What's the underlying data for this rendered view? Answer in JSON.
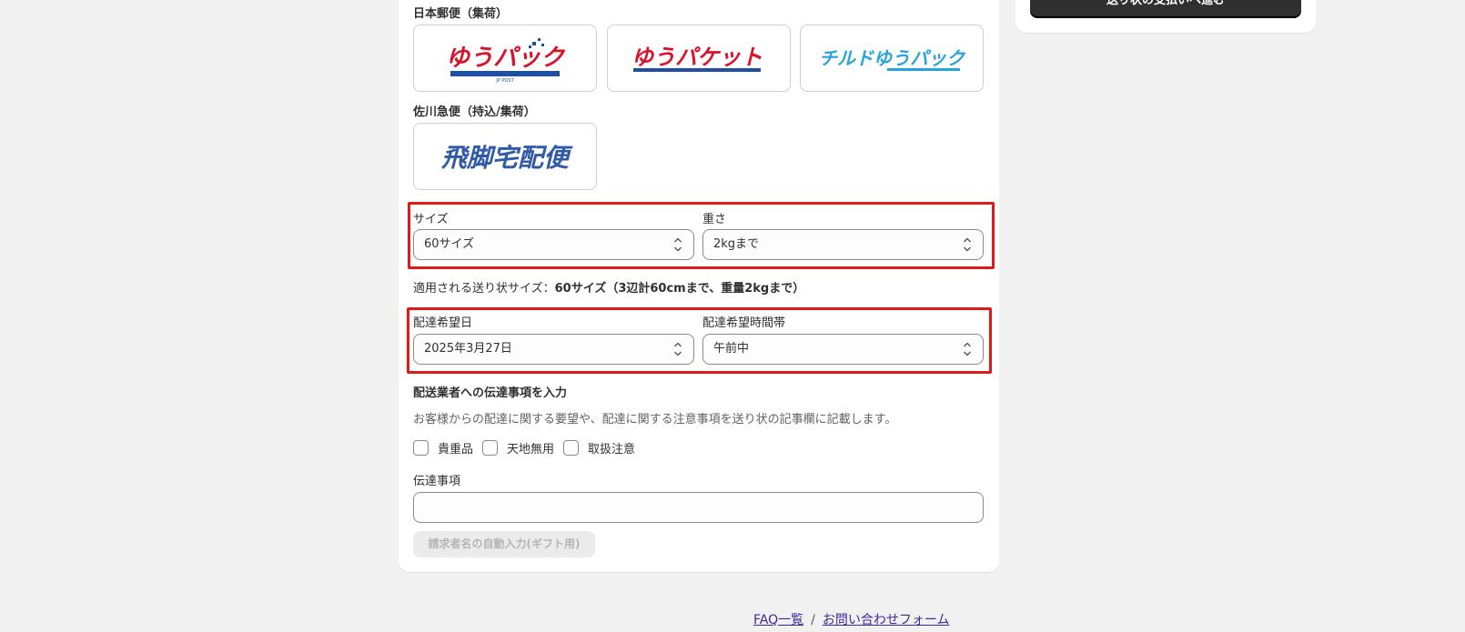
{
  "sidebar": {
    "proceed_button": "送り状の支払いへ進む"
  },
  "carriers": {
    "japan_post_label": "日本郵便（集荷）",
    "japan_post_logos": [
      "ゆうパック",
      "ゆうパケット",
      "チルドゆうパック"
    ],
    "jp_post_sub": "JP POST",
    "sagawa_label": "佐川急便（持込/集荷）",
    "sagawa_logo": "飛脚宅配便"
  },
  "size_weight": {
    "size_label": "サイズ",
    "size_value": "60サイズ",
    "weight_label": "重さ",
    "weight_value": "2kgまで"
  },
  "applied_size": {
    "prefix": "適用される送り状サイズ：",
    "value": "60サイズ（3辺計60cmまで、重量2kgまで）"
  },
  "delivery": {
    "date_label": "配達希望日",
    "date_value": "2025年3月27日",
    "time_label": "配達希望時間帯",
    "time_value": "午前中"
  },
  "notes": {
    "heading": "配送業者への伝達事項を入力",
    "description": "お客様からの配達に関する要望や、配達に関する注意事項を送り状の記事欄に記載します。",
    "checkboxes": [
      "貴重品",
      "天地無用",
      "取扱注意"
    ],
    "message_label": "伝達事項",
    "message_value": "",
    "gift_button": "請求者名の自動入力(ギフト用)"
  },
  "footer": {
    "faq_link": "FAQ一覧",
    "separator": "/",
    "contact_link": "お問い合わせフォーム"
  },
  "colors": {
    "highlight": "#e11919",
    "yupack_red": "#d6142a",
    "yupack_blue": "#1f4fa0",
    "chilled_blue": "#29a3dd",
    "sagawa_blue": "#2f5aa8"
  }
}
